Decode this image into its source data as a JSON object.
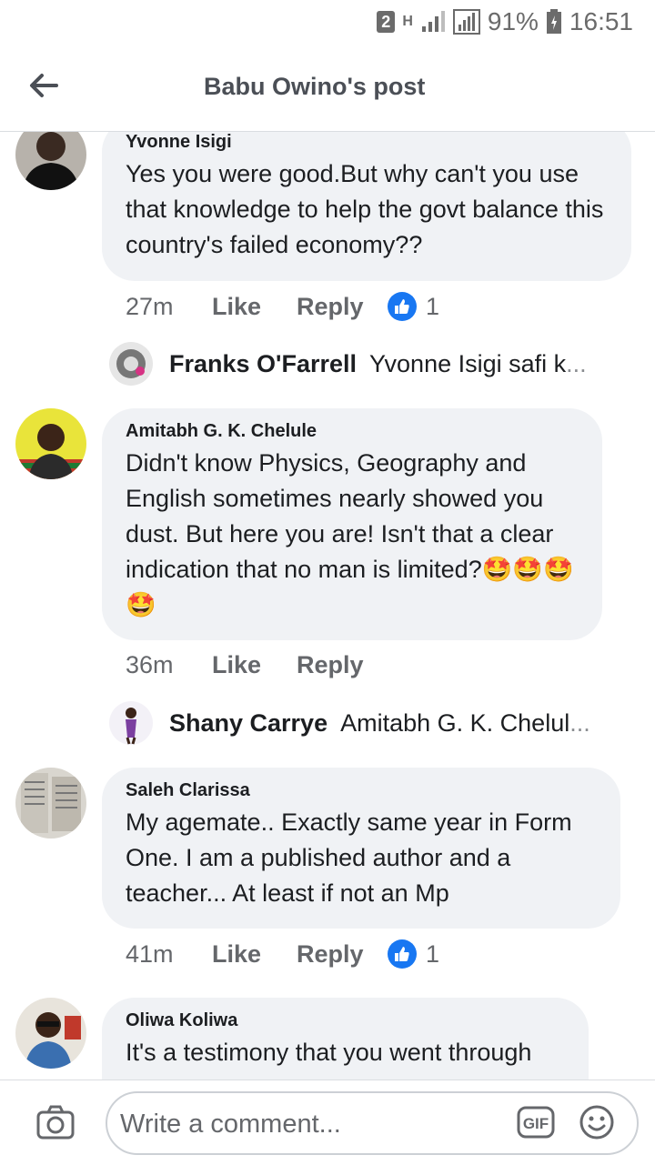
{
  "status": {
    "sim": "2",
    "network": "H",
    "battery": "91%",
    "time": "16:51"
  },
  "header": {
    "title": "Babu Owino's post"
  },
  "comments": [
    {
      "author": "Yvonne Isigi",
      "text": "Yes you were good.But why can't you use that knowledge to help the govt balance this country's failed economy??",
      "time": "27m",
      "like_label": "Like",
      "reply_label": "Reply",
      "likes": "1",
      "reply": {
        "name": "Franks O'Farrell",
        "snippet": "Yvonne Isigi safi k",
        "ellipsis": "..."
      }
    },
    {
      "author": "Amitabh G. K. Chelule",
      "text": "Didn't know Physics, Geography and English sometimes nearly showed you dust. But here you are! Isn't that a clear indication that no man is limited?🤩🤩🤩🤩",
      "time": "36m",
      "like_label": "Like",
      "reply_label": "Reply",
      "reply": {
        "name": "Shany Carrye",
        "snippet": "Amitabh G. K. Chelul",
        "ellipsis": "..."
      }
    },
    {
      "author": "Saleh Clarissa",
      "text": "My agemate.. Exactly same year in Form One. I am a published author and a teacher... At least if not an Mp",
      "time": "41m",
      "like_label": "Like",
      "reply_label": "Reply",
      "likes": "1"
    },
    {
      "author": "Oliwa Koliwa",
      "text": "It's a testimony that you went through"
    }
  ],
  "composer": {
    "placeholder": "Write a comment...",
    "gif": "GIF"
  },
  "colors": {
    "like_blue": "#1877f2",
    "bubble": "#f0f2f5",
    "secondary_text": "#65676b"
  }
}
